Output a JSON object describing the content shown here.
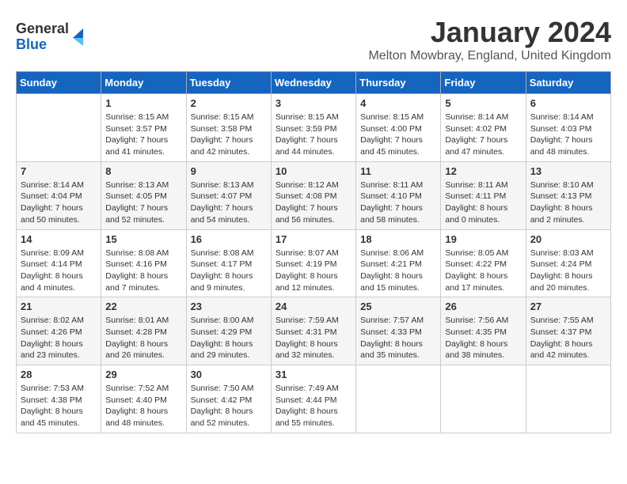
{
  "logo": {
    "general": "General",
    "blue": "Blue"
  },
  "title": "January 2024",
  "location": "Melton Mowbray, England, United Kingdom",
  "weekdays": [
    "Sunday",
    "Monday",
    "Tuesday",
    "Wednesday",
    "Thursday",
    "Friday",
    "Saturday"
  ],
  "weeks": [
    [
      {
        "day": "",
        "info": ""
      },
      {
        "day": "1",
        "info": "Sunrise: 8:15 AM\nSunset: 3:57 PM\nDaylight: 7 hours\nand 41 minutes."
      },
      {
        "day": "2",
        "info": "Sunrise: 8:15 AM\nSunset: 3:58 PM\nDaylight: 7 hours\nand 42 minutes."
      },
      {
        "day": "3",
        "info": "Sunrise: 8:15 AM\nSunset: 3:59 PM\nDaylight: 7 hours\nand 44 minutes."
      },
      {
        "day": "4",
        "info": "Sunrise: 8:15 AM\nSunset: 4:00 PM\nDaylight: 7 hours\nand 45 minutes."
      },
      {
        "day": "5",
        "info": "Sunrise: 8:14 AM\nSunset: 4:02 PM\nDaylight: 7 hours\nand 47 minutes."
      },
      {
        "day": "6",
        "info": "Sunrise: 8:14 AM\nSunset: 4:03 PM\nDaylight: 7 hours\nand 48 minutes."
      }
    ],
    [
      {
        "day": "7",
        "info": "Sunrise: 8:14 AM\nSunset: 4:04 PM\nDaylight: 7 hours\nand 50 minutes."
      },
      {
        "day": "8",
        "info": "Sunrise: 8:13 AM\nSunset: 4:05 PM\nDaylight: 7 hours\nand 52 minutes."
      },
      {
        "day": "9",
        "info": "Sunrise: 8:13 AM\nSunset: 4:07 PM\nDaylight: 7 hours\nand 54 minutes."
      },
      {
        "day": "10",
        "info": "Sunrise: 8:12 AM\nSunset: 4:08 PM\nDaylight: 7 hours\nand 56 minutes."
      },
      {
        "day": "11",
        "info": "Sunrise: 8:11 AM\nSunset: 4:10 PM\nDaylight: 7 hours\nand 58 minutes."
      },
      {
        "day": "12",
        "info": "Sunrise: 8:11 AM\nSunset: 4:11 PM\nDaylight: 8 hours\nand 0 minutes."
      },
      {
        "day": "13",
        "info": "Sunrise: 8:10 AM\nSunset: 4:13 PM\nDaylight: 8 hours\nand 2 minutes."
      }
    ],
    [
      {
        "day": "14",
        "info": "Sunrise: 8:09 AM\nSunset: 4:14 PM\nDaylight: 8 hours\nand 4 minutes."
      },
      {
        "day": "15",
        "info": "Sunrise: 8:08 AM\nSunset: 4:16 PM\nDaylight: 8 hours\nand 7 minutes."
      },
      {
        "day": "16",
        "info": "Sunrise: 8:08 AM\nSunset: 4:17 PM\nDaylight: 8 hours\nand 9 minutes."
      },
      {
        "day": "17",
        "info": "Sunrise: 8:07 AM\nSunset: 4:19 PM\nDaylight: 8 hours\nand 12 minutes."
      },
      {
        "day": "18",
        "info": "Sunrise: 8:06 AM\nSunset: 4:21 PM\nDaylight: 8 hours\nand 15 minutes."
      },
      {
        "day": "19",
        "info": "Sunrise: 8:05 AM\nSunset: 4:22 PM\nDaylight: 8 hours\nand 17 minutes."
      },
      {
        "day": "20",
        "info": "Sunrise: 8:03 AM\nSunset: 4:24 PM\nDaylight: 8 hours\nand 20 minutes."
      }
    ],
    [
      {
        "day": "21",
        "info": "Sunrise: 8:02 AM\nSunset: 4:26 PM\nDaylight: 8 hours\nand 23 minutes."
      },
      {
        "day": "22",
        "info": "Sunrise: 8:01 AM\nSunset: 4:28 PM\nDaylight: 8 hours\nand 26 minutes."
      },
      {
        "day": "23",
        "info": "Sunrise: 8:00 AM\nSunset: 4:29 PM\nDaylight: 8 hours\nand 29 minutes."
      },
      {
        "day": "24",
        "info": "Sunrise: 7:59 AM\nSunset: 4:31 PM\nDaylight: 8 hours\nand 32 minutes."
      },
      {
        "day": "25",
        "info": "Sunrise: 7:57 AM\nSunset: 4:33 PM\nDaylight: 8 hours\nand 35 minutes."
      },
      {
        "day": "26",
        "info": "Sunrise: 7:56 AM\nSunset: 4:35 PM\nDaylight: 8 hours\nand 38 minutes."
      },
      {
        "day": "27",
        "info": "Sunrise: 7:55 AM\nSunset: 4:37 PM\nDaylight: 8 hours\nand 42 minutes."
      }
    ],
    [
      {
        "day": "28",
        "info": "Sunrise: 7:53 AM\nSunset: 4:38 PM\nDaylight: 8 hours\nand 45 minutes."
      },
      {
        "day": "29",
        "info": "Sunrise: 7:52 AM\nSunset: 4:40 PM\nDaylight: 8 hours\nand 48 minutes."
      },
      {
        "day": "30",
        "info": "Sunrise: 7:50 AM\nSunset: 4:42 PM\nDaylight: 8 hours\nand 52 minutes."
      },
      {
        "day": "31",
        "info": "Sunrise: 7:49 AM\nSunset: 4:44 PM\nDaylight: 8 hours\nand 55 minutes."
      },
      {
        "day": "",
        "info": ""
      },
      {
        "day": "",
        "info": ""
      },
      {
        "day": "",
        "info": ""
      }
    ]
  ]
}
